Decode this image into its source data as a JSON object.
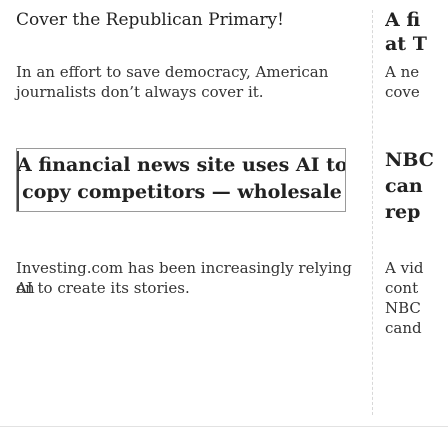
{
  "left": {
    "story1": {
      "headline": "Cover the Republican Primary!",
      "dek_line1": "In an effort to save democracy, American",
      "dek_line2": "journalists don’t always cover it."
    },
    "story2": {
      "headline_line1": "A financial news site uses AI to",
      "headline_line2": "copy competitors — wholesale",
      "dek_line1": "Investing.com has been increasingly relying on",
      "dek_line2": "AI to create its stories."
    }
  },
  "right": {
    "story1": {
      "headline_line1": "A fi",
      "headline_line2": "at T",
      "dek_line1": "A ne",
      "dek_line2": "cove"
    },
    "story2": {
      "headline_line1": "NBC",
      "headline_line2": "can",
      "headline_line3": "rep",
      "dek_line1": "A vid",
      "dek_line2": "cont",
      "dek_line3": "NBC",
      "dek_line4": "cand"
    }
  }
}
